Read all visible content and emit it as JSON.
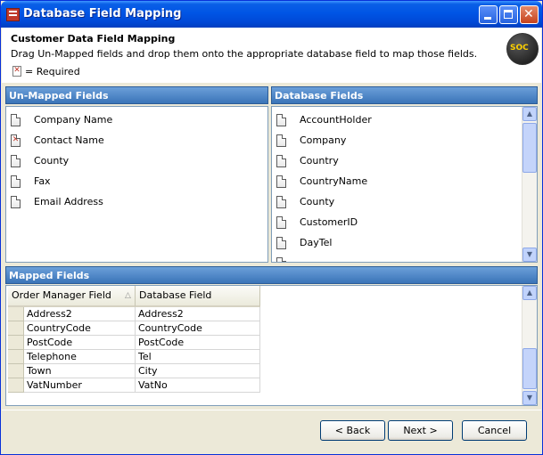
{
  "window": {
    "title": "Database Field Mapping"
  },
  "header": {
    "title": "Customer Data Field Mapping",
    "description": "Drag Un-Mapped fields and drop them onto the appropriate database field to map those fields.",
    "required_legend": "= Required",
    "logo_text": "SOC"
  },
  "unmapped": {
    "title": "Un-Mapped Fields",
    "items": [
      {
        "label": "Company Name",
        "required": false
      },
      {
        "label": "Contact Name",
        "required": true
      },
      {
        "label": "County",
        "required": false
      },
      {
        "label": "Fax",
        "required": false
      },
      {
        "label": "Email Address",
        "required": false
      }
    ]
  },
  "database": {
    "title": "Database Fields",
    "items": [
      "AccountHolder",
      "Company",
      "Country",
      "CountryName",
      "County",
      "CustomerID",
      "DayTel"
    ]
  },
  "mapped": {
    "title": "Mapped Fields",
    "columns": [
      "Order Manager Field",
      "Database Field"
    ],
    "rows": [
      [
        "Address2",
        "Address2"
      ],
      [
        "CountryCode",
        "CountryCode"
      ],
      [
        "PostCode",
        "PostCode"
      ],
      [
        "Telephone",
        "Tel"
      ],
      [
        "Town",
        "City"
      ],
      [
        "VatNumber",
        "VatNo"
      ]
    ]
  },
  "buttons": {
    "back": "< Back",
    "next": "Next >",
    "cancel": "Cancel"
  },
  "colors": {
    "title_bar": "#0055e5",
    "section_bar": "#4a83c6",
    "dialog_bg": "#ece9d8"
  }
}
